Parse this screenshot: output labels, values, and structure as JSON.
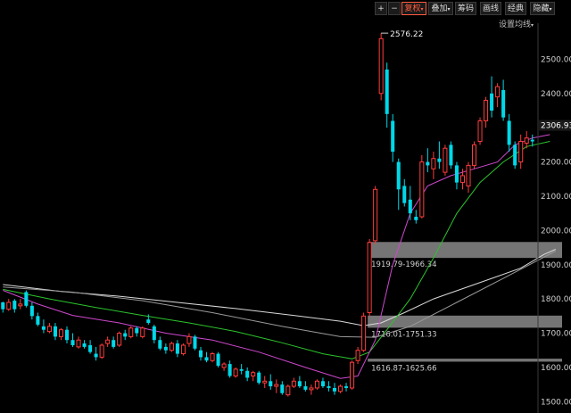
{
  "toolbar": {
    "plus_label": "+",
    "minus_label": "−",
    "fuquan_label": "复权",
    "overlay_label": "叠加",
    "chips_label": "筹码",
    "draw_label": "画线",
    "classic_label": "经典",
    "hide_label": "隐藏"
  },
  "ma_setting_label": "设置均线",
  "colors": {
    "up": "#ff3c3c",
    "down": "#00d8e8",
    "ma_white": "#d9d9d9",
    "ma_magenta": "#d048d0",
    "ma_green": "#2cc42c",
    "ma_gray": "#9a9a9a",
    "zone": "#8a8a8a"
  },
  "chart_data": {
    "type": "candlestick",
    "ylim": [
      1480,
      2600
    ],
    "y_ticks": [
      "2500.00",
      "2400.00",
      "2300.00",
      "2200.00",
      "2100.00",
      "2000.00",
      "1900.00",
      "1800.00",
      "1700.00",
      "1600.00",
      "1500.00"
    ],
    "y_tick_values": [
      2500,
      2400,
      2300,
      2200,
      2100,
      2000,
      1900,
      1800,
      1700,
      1600,
      1500
    ],
    "current_price": "2306.93",
    "current_value": 2306.93,
    "peak_label": "2576.22",
    "peak_value": 2576.22,
    "zones": [
      {
        "label": "1919.79-1966.34",
        "low": 1919.79,
        "high": 1966.34
      },
      {
        "label": "1716.01-1751.33",
        "low": 1716.01,
        "high": 1751.33
      },
      {
        "label": "1616.87-1625.66",
        "low": 1616.87,
        "high": 1625.66
      }
    ],
    "candles": [
      [
        1790,
        1792,
        1760,
        1770
      ],
      [
        1770,
        1800,
        1765,
        1790
      ],
      [
        1795,
        1800,
        1760,
        1770
      ],
      [
        1780,
        1800,
        1770,
        1785
      ],
      [
        1820,
        1825,
        1775,
        1780
      ],
      [
        1780,
        1790,
        1740,
        1750
      ],
      [
        1750,
        1760,
        1720,
        1725
      ],
      [
        1720,
        1740,
        1700,
        1710
      ],
      [
        1705,
        1730,
        1700,
        1720
      ],
      [
        1720,
        1730,
        1680,
        1690
      ],
      [
        1690,
        1715,
        1680,
        1710
      ],
      [
        1710,
        1720,
        1670,
        1680
      ],
      [
        1680,
        1700,
        1660,
        1665
      ],
      [
        1660,
        1690,
        1655,
        1680
      ],
      [
        1670,
        1680,
        1655,
        1660
      ],
      [
        1665,
        1680,
        1640,
        1645
      ],
      [
        1640,
        1660,
        1620,
        1630
      ],
      [
        1630,
        1670,
        1625,
        1665
      ],
      [
        1670,
        1690,
        1660,
        1680
      ],
      [
        1680,
        1690,
        1655,
        1660
      ],
      [
        1665,
        1705,
        1660,
        1700
      ],
      [
        1700,
        1710,
        1680,
        1690
      ],
      [
        1690,
        1720,
        1685,
        1715
      ],
      [
        1715,
        1720,
        1690,
        1700
      ],
      [
        1690,
        1720,
        1685,
        1715
      ],
      [
        1740,
        1755,
        1725,
        1730
      ],
      [
        1720,
        1725,
        1670,
        1680
      ],
      [
        1680,
        1690,
        1650,
        1655
      ],
      [
        1660,
        1670,
        1640,
        1650
      ],
      [
        1650,
        1675,
        1645,
        1670
      ],
      [
        1670,
        1680,
        1630,
        1640
      ],
      [
        1640,
        1670,
        1635,
        1665
      ],
      [
        1670,
        1700,
        1660,
        1690
      ],
      [
        1690,
        1695,
        1650,
        1655
      ],
      [
        1650,
        1660,
        1620,
        1630
      ],
      [
        1630,
        1645,
        1615,
        1620
      ],
      [
        1620,
        1645,
        1615,
        1640
      ],
      [
        1640,
        1645,
        1600,
        1605
      ],
      [
        1600,
        1615,
        1590,
        1610
      ],
      [
        1610,
        1620,
        1570,
        1575
      ],
      [
        1575,
        1600,
        1570,
        1595
      ],
      [
        1595,
        1610,
        1580,
        1590
      ],
      [
        1590,
        1600,
        1560,
        1570
      ],
      [
        1575,
        1590,
        1560,
        1585
      ],
      [
        1585,
        1590,
        1550,
        1555
      ],
      [
        1555,
        1575,
        1540,
        1560
      ],
      [
        1560,
        1580,
        1535,
        1545
      ],
      [
        1545,
        1565,
        1525,
        1550
      ],
      [
        1550,
        1560,
        1520,
        1525
      ],
      [
        1520,
        1550,
        1515,
        1545
      ],
      [
        1545,
        1570,
        1540,
        1560
      ],
      [
        1560,
        1575,
        1540,
        1545
      ],
      [
        1545,
        1560,
        1530,
        1535
      ],
      [
        1535,
        1550,
        1520,
        1540
      ],
      [
        1540,
        1565,
        1535,
        1560
      ],
      [
        1560,
        1570,
        1540,
        1545
      ],
      [
        1545,
        1560,
        1530,
        1540
      ],
      [
        1540,
        1555,
        1520,
        1530
      ],
      [
        1530,
        1550,
        1525,
        1545
      ],
      [
        1545,
        1555,
        1530,
        1540
      ],
      [
        1540,
        1620,
        1535,
        1615
      ],
      [
        1620,
        1660,
        1610,
        1650
      ],
      [
        1650,
        1760,
        1645,
        1750
      ],
      [
        1760,
        1975,
        1750,
        1965
      ],
      [
        1970,
        2130,
        1960,
        2120
      ],
      [
        2400,
        2576,
        2380,
        2560
      ],
      [
        2470,
        2490,
        2300,
        2340
      ],
      [
        2320,
        2340,
        2200,
        2230
      ],
      [
        2200,
        2210,
        2060,
        2120
      ],
      [
        2130,
        2150,
        2070,
        2080
      ],
      [
        2090,
        2130,
        2030,
        2050
      ],
      [
        2040,
        2060,
        2020,
        2030
      ],
      [
        2040,
        2220,
        2035,
        2200
      ],
      [
        2200,
        2240,
        2170,
        2190
      ],
      [
        2180,
        2230,
        2150,
        2210
      ],
      [
        2210,
        2260,
        2180,
        2200
      ],
      [
        2170,
        2250,
        2160,
        2240
      ],
      [
        2250,
        2260,
        2180,
        2190
      ],
      [
        2190,
        2200,
        2120,
        2140
      ],
      [
        2140,
        2180,
        2120,
        2160
      ],
      [
        2130,
        2200,
        2110,
        2190
      ],
      [
        2190,
        2260,
        2180,
        2250
      ],
      [
        2260,
        2330,
        2250,
        2320
      ],
      [
        2320,
        2390,
        2300,
        2380
      ],
      [
        2400,
        2450,
        2330,
        2350
      ],
      [
        2390,
        2430,
        2360,
        2420
      ],
      [
        2410,
        2440,
        2320,
        2330
      ],
      [
        2320,
        2340,
        2230,
        2250
      ],
      [
        2250,
        2260,
        2180,
        2190
      ],
      [
        2200,
        2280,
        2180,
        2260
      ],
      [
        2255,
        2290,
        2240,
        2270
      ],
      [
        2265,
        2280,
        2245,
        2260
      ]
    ],
    "ma_series": [
      {
        "color_key": "ma_white",
        "points": [
          [
            0,
            1842
          ],
          [
            10,
            1822
          ],
          [
            20,
            1808
          ],
          [
            30,
            1790
          ],
          [
            40,
            1772
          ],
          [
            50,
            1752
          ],
          [
            58,
            1735
          ],
          [
            62,
            1722
          ],
          [
            65,
            1730
          ],
          [
            69,
            1760
          ],
          [
            74,
            1800
          ],
          [
            79,
            1830
          ],
          [
            84,
            1860
          ],
          [
            89,
            1890
          ],
          [
            93,
            1930
          ],
          [
            95,
            1945
          ]
        ]
      },
      {
        "color_key": "ma_green",
        "points": [
          [
            0,
            1828
          ],
          [
            8,
            1800
          ],
          [
            16,
            1775
          ],
          [
            24,
            1752
          ],
          [
            32,
            1730
          ],
          [
            40,
            1705
          ],
          [
            48,
            1672
          ],
          [
            55,
            1640
          ],
          [
            60,
            1625
          ],
          [
            63,
            1645
          ],
          [
            66,
            1710
          ],
          [
            70,
            1800
          ],
          [
            74,
            1920
          ],
          [
            78,
            2050
          ],
          [
            82,
            2140
          ],
          [
            86,
            2200
          ],
          [
            90,
            2245
          ],
          [
            94,
            2260
          ]
        ]
      },
      {
        "color_key": "ma_magenta",
        "points": [
          [
            0,
            1825
          ],
          [
            6,
            1785
          ],
          [
            12,
            1752
          ],
          [
            20,
            1730
          ],
          [
            28,
            1700
          ],
          [
            36,
            1680
          ],
          [
            44,
            1645
          ],
          [
            52,
            1600
          ],
          [
            58,
            1568
          ],
          [
            61,
            1575
          ],
          [
            64,
            1680
          ],
          [
            67,
            1900
          ],
          [
            70,
            2050
          ],
          [
            73,
            2130
          ],
          [
            77,
            2160
          ],
          [
            81,
            2180
          ],
          [
            85,
            2200
          ],
          [
            88,
            2250
          ],
          [
            91,
            2270
          ],
          [
            94,
            2280
          ]
        ]
      },
      {
        "color_key": "ma_gray",
        "points": [
          [
            0,
            1835
          ],
          [
            12,
            1820
          ],
          [
            24,
            1795
          ],
          [
            36,
            1760
          ],
          [
            48,
            1720
          ],
          [
            58,
            1690
          ],
          [
            64,
            1688
          ],
          [
            70,
            1720
          ],
          [
            78,
            1790
          ],
          [
            86,
            1860
          ],
          [
            95,
            1940
          ]
        ]
      }
    ]
  }
}
